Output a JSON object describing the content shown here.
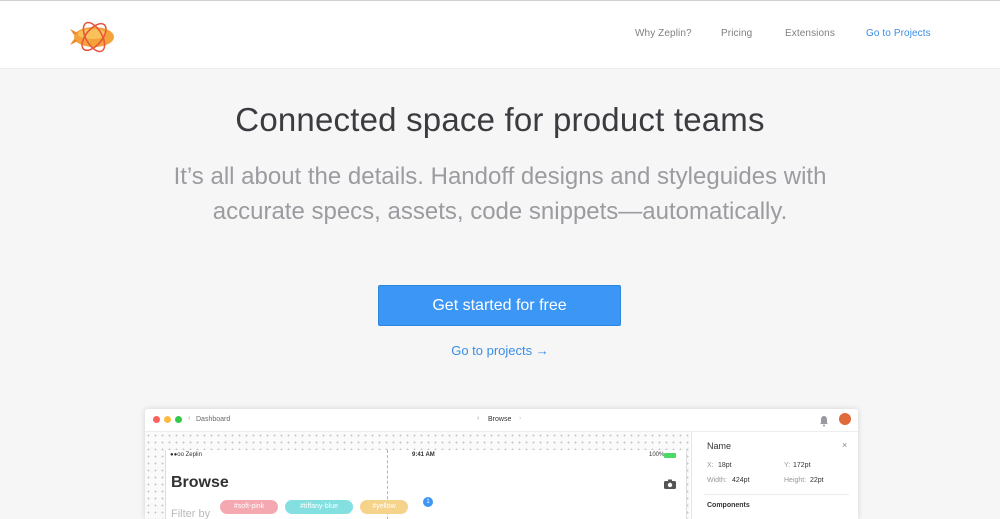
{
  "nav": {
    "items": [
      {
        "label": "Why Zeplin?"
      },
      {
        "label": "Pricing"
      },
      {
        "label": "Extensions"
      },
      {
        "label": "Go to Projects"
      }
    ]
  },
  "hero": {
    "title": "Connected space for product teams",
    "subtitle_line1": "It’s all about the details. Handoff designs and styleguides with",
    "subtitle_line2": "accurate specs, assets, code snippets—automatically.",
    "cta_label": "Get started for free",
    "link_label": "Go to projects →"
  },
  "mockup": {
    "back_label": "Dashboard",
    "screen_title": "Browse",
    "status_carrier": "●●oo Zeplin",
    "status_time": "9:41 AM",
    "status_battery": "100%",
    "page_heading": "Browse",
    "filter_label": "Filter by",
    "chips": [
      "#soft-pink",
      "#tiffany-blue",
      "#yellow"
    ],
    "badge_count": "1",
    "panel": {
      "title": "Name",
      "x_label": "X:",
      "x_value": "18pt",
      "y_label": "Y:",
      "y_value": "172pt",
      "w_label": "Width:",
      "w_value": "424pt",
      "h_label": "Height:",
      "h_value": "22pt",
      "section": "Components"
    }
  },
  "colors": {
    "accent": "#3b96f5",
    "link": "#3a8ee6",
    "chip_pink": "#f4a9b0",
    "chip_blue": "#83dfe0",
    "chip_yellow": "#f5d38a"
  }
}
